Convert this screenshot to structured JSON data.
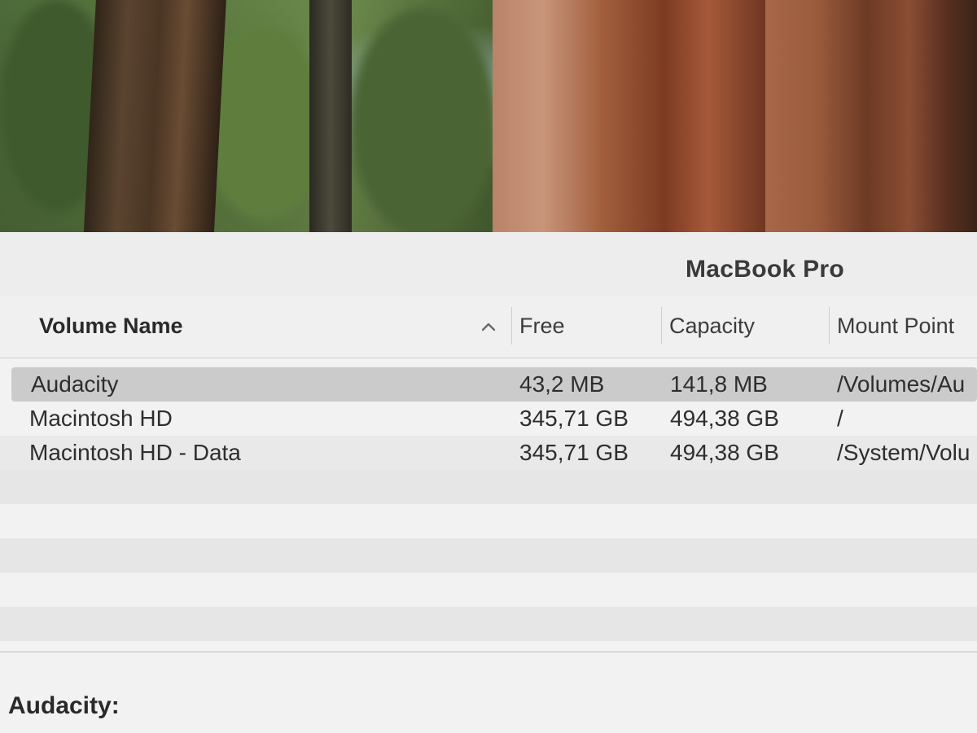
{
  "window": {
    "title": "MacBook Pro"
  },
  "table": {
    "columns": {
      "name": "Volume Name",
      "free": "Free",
      "capacity": "Capacity",
      "mount": "Mount Point"
    },
    "sort": {
      "column": "Volume Name",
      "direction": "ascending",
      "icon": "chevron-up-icon"
    },
    "rows": [
      {
        "name": "Audacity",
        "free": "43,2 MB",
        "capacity": "141,8 MB",
        "mount": "/Volumes/Au",
        "selected": true
      },
      {
        "name": "Macintosh HD",
        "free": "345,71 GB",
        "capacity": "494,38 GB",
        "mount": "/",
        "selected": false
      },
      {
        "name": "Macintosh HD - Data",
        "free": "345,71 GB",
        "capacity": "494,38 GB",
        "mount": "/System/Volu",
        "selected": false
      }
    ]
  },
  "details": {
    "label": "Audacity:"
  }
}
